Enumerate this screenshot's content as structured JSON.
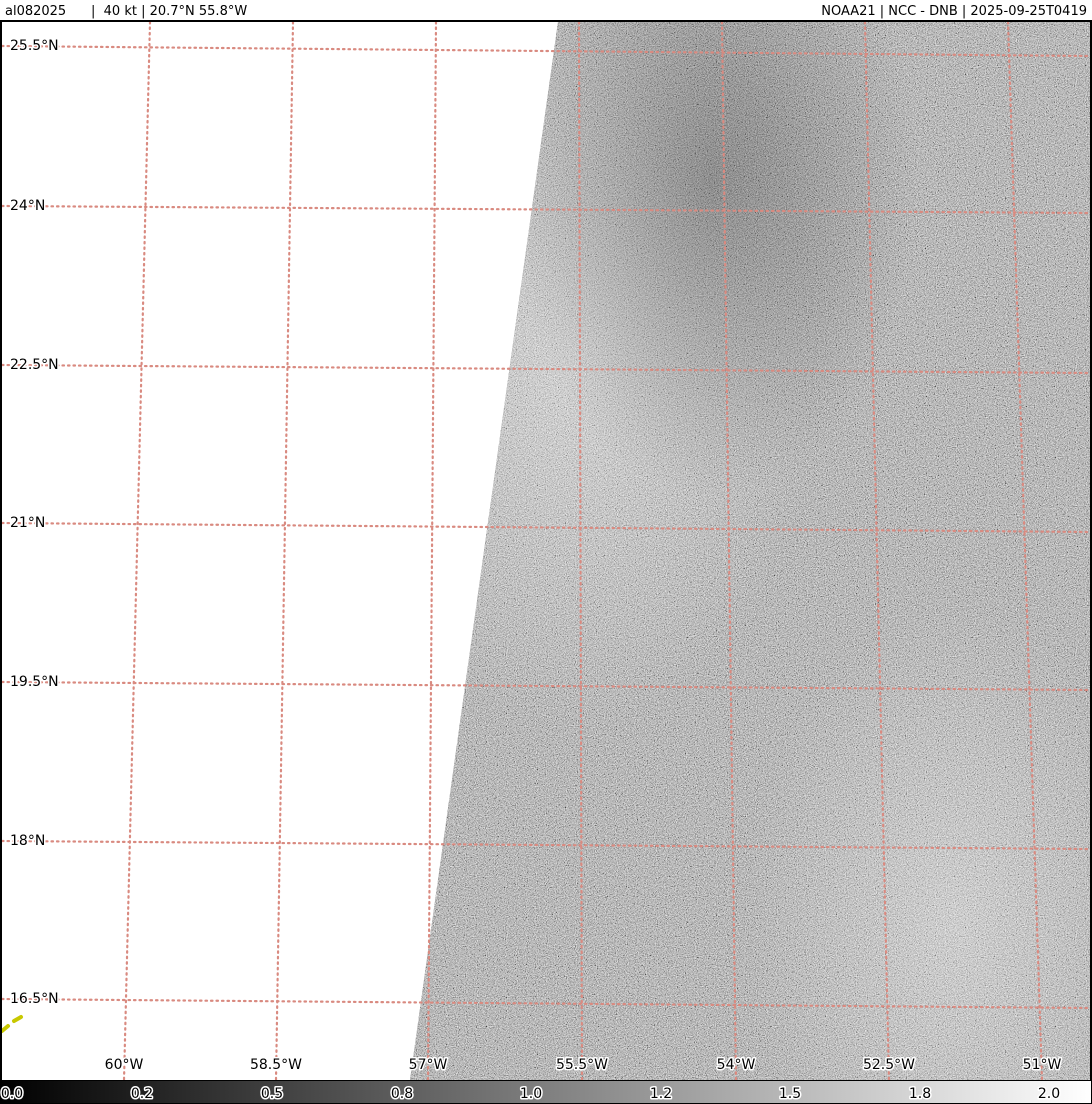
{
  "header": {
    "storm": "al082025",
    "intensity": "40 kt",
    "position": "20.7°N 55.8°W",
    "left_text": "al082025      |  40 kt | 20.7°N 55.8°W",
    "right_text": "NOAA21 | NCC - DNB | 2025-09-25T0419"
  },
  "map": {
    "grid_color": "#d98a80",
    "swath_colors": [
      "#4a4a4a",
      "#7a7a7a",
      "#a8a8a8",
      "#d0d0d0"
    ],
    "track_color": "#c8c800",
    "lat_labels": [
      "25.5°N",
      "24°N",
      "22.5°N",
      "21°N",
      "19.5°N",
      "18°N",
      "16.5°N"
    ],
    "lon_labels": [
      "60°W",
      "58.5°W",
      "57°W",
      "55.5°W",
      "54°W",
      "52.5°W",
      "51°W"
    ]
  },
  "colorbar": {
    "colormap": "greys",
    "ticks": [
      "0.0",
      "0.2",
      "0.5",
      "0.8",
      "1.0",
      "1.2",
      "1.5",
      "1.8",
      "2.0"
    ]
  }
}
